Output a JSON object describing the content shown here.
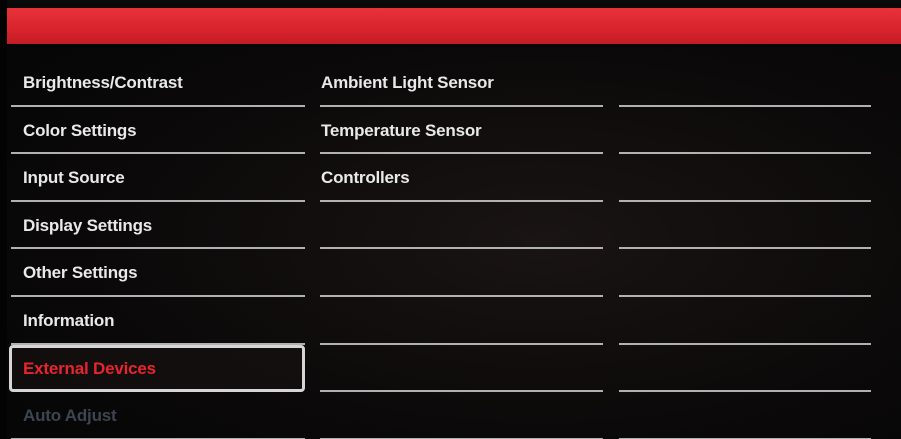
{
  "menu": {
    "main_items": [
      {
        "label": "Brightness/Contrast"
      },
      {
        "label": "Color Settings"
      },
      {
        "label": "Input Source"
      },
      {
        "label": "Display Settings"
      },
      {
        "label": "Other Settings"
      },
      {
        "label": "Information"
      },
      {
        "label": "External Devices",
        "state": "selected"
      },
      {
        "label": "Auto Adjust",
        "state": "disabled"
      }
    ],
    "sub_items": [
      {
        "label": "Ambient Light Sensor"
      },
      {
        "label": "Temperature Sensor"
      },
      {
        "label": "Controllers"
      }
    ]
  },
  "colors": {
    "header_red": "#d8232c",
    "selected_text": "#e8242c",
    "normal_text": "#e9e9e9",
    "disabled_text": "#3d4550",
    "divider": "#cfcfcf"
  }
}
